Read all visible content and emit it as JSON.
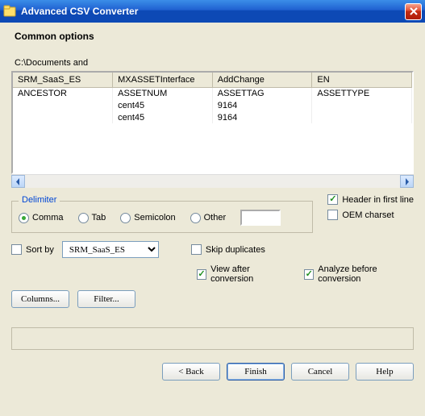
{
  "titlebar": {
    "title": "Advanced CSV Converter"
  },
  "section_title": "Common options",
  "file_path": "C:\\Documents and",
  "grid": {
    "headers": [
      "SRM_SaaS_ES",
      "MXASSETInterface",
      "AddChange",
      "EN"
    ],
    "rows": [
      [
        "ANCESTOR",
        "ASSETNUM",
        "ASSETTAG",
        "ASSETTYPE"
      ],
      [
        "",
        "cent45",
        "9164",
        ""
      ],
      [
        "",
        "cent45",
        "9164",
        ""
      ]
    ]
  },
  "delimiter": {
    "legend": "Delimiter",
    "comma": "Comma",
    "tab": "Tab",
    "semicolon": "Semicolon",
    "other": "Other"
  },
  "options": {
    "header_first": "Header in first line",
    "oem_charset": "OEM charset",
    "sort_by": "Sort by",
    "skip_dup": "Skip duplicates",
    "view_after": "View after conversion",
    "analyze_before": "Analyze before conversion"
  },
  "sort_by_value": "SRM_SaaS_ES",
  "buttons": {
    "columns": "Columns...",
    "filter": "Filter...",
    "back": "< Back",
    "finish": "Finish",
    "cancel": "Cancel",
    "help": "Help"
  }
}
